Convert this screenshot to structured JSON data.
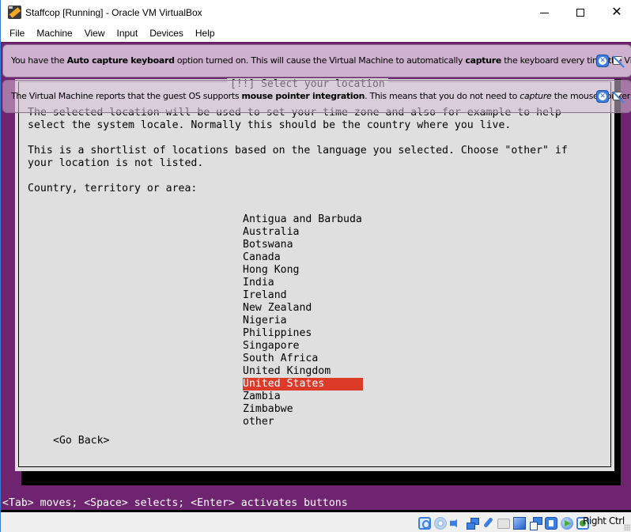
{
  "window": {
    "title": "Staffcop [Running] - Oracle VM VirtualBox",
    "controls": {
      "minimize": "minimize",
      "maximize": "maximize",
      "close": "✕"
    }
  },
  "menubar": {
    "items": [
      {
        "label": "File"
      },
      {
        "label": "Machine"
      },
      {
        "label": "View"
      },
      {
        "label": "Input"
      },
      {
        "label": "Devices"
      },
      {
        "label": "Help"
      }
    ]
  },
  "notices": [
    {
      "parts": [
        {
          "text": "You have the ",
          "style": "normal"
        },
        {
          "text": "Auto capture keyboard",
          "style": "bold"
        },
        {
          "text": " option turned on. This will cause the Virtual Machine to automatically ",
          "style": "normal"
        },
        {
          "text": "capture",
          "style": "bold"
        },
        {
          "text": " the keyboard every time the VM",
          "style": "normal"
        }
      ]
    },
    {
      "parts": [
        {
          "text": "The Virtual Machine reports that the guest OS supports ",
          "style": "normal"
        },
        {
          "text": "mouse pointer integration",
          "style": "bold"
        },
        {
          "text": ". This means that you do not need to ",
          "style": "normal"
        },
        {
          "text": "capture",
          "style": "italic"
        },
        {
          "text": " the mouse pointer",
          "style": "normal"
        }
      ]
    }
  ],
  "installer": {
    "dialog_title": "[!!] Select your location",
    "paragraph1": "The selected location will be used to set your time zone and also for example to help\nselect the system locale. Normally this should be the country where you live.",
    "paragraph2": "This is a shortlist of locations based on the language you selected. Choose \"other\" if\nyour location is not listed.",
    "prompt": "Country, territory or area:",
    "countries": [
      "Antigua and Barbuda",
      "Australia",
      "Botswana",
      "Canada",
      "Hong Kong",
      "India",
      "Ireland",
      "New Zealand",
      "Nigeria",
      "Philippines",
      "Singapore",
      "South Africa",
      "United Kingdom",
      "United States",
      "Zambia",
      "Zimbabwe",
      "other"
    ],
    "selected_country": "United States",
    "go_back": "<Go Back>",
    "help_line": "<Tab> moves; <Space> selects; <Enter> activates buttons",
    "colors": {
      "background": "#6f2470",
      "dialog": "#dfdfdf",
      "selection": "#dc3b2a"
    }
  },
  "statusbar": {
    "icons": [
      "hard-disk-icon",
      "optical-drive-icon",
      "audio-icon",
      "network-icon",
      "usb-icon",
      "shared-folders-icon",
      "display-icon",
      "video-capture-icon",
      "cpu-virtualization-icon",
      "mouse-integration-icon",
      "keyboard-capture-icon"
    ],
    "host_key": "Right Ctrl"
  }
}
